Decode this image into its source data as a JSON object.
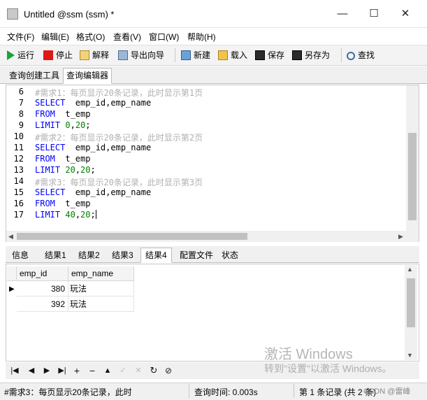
{
  "window": {
    "title": "Untitled @ssm (ssm) *",
    "minimize": "—",
    "maximize": "☐",
    "close": "✕"
  },
  "menu": [
    "文件(F)",
    "编辑(E)",
    "格式(O)",
    "查看(V)",
    "窗口(W)",
    "帮助(H)"
  ],
  "toolbar": {
    "run": "运行",
    "stop": "停止",
    "explain": "解释",
    "export": "导出向导",
    "new": "新建",
    "load": "载入",
    "save": "保存",
    "save_as": "另存为",
    "find": "查找"
  },
  "query_tabs": [
    "查询创建工具",
    "查询编辑器"
  ],
  "editor": {
    "line_numbers": [
      "6",
      "7",
      "8",
      "9",
      "10",
      "11",
      "12",
      "13",
      "14",
      "15",
      "16",
      "17"
    ],
    "lines": {
      "l6": "#需求1：每页显示20条记录，此时显示第1页",
      "l7_kw": "SELECT",
      "l7_rest": "  emp_id,emp_name",
      "l8_kw": "FROM",
      "l8_rest": "  t_emp",
      "l9_kw": "LIMIT",
      "l9_a": "0",
      "l9_sep": ",",
      "l9_b": "20",
      "l9_end": ";",
      "l10": "#需求2：每页显示20条记录，此时显示第2页",
      "l11_kw": "SELECT",
      "l11_rest": "  emp_id,emp_name",
      "l12_kw": "FROM",
      "l12_rest": "  t_emp",
      "l13_kw": "LIMIT",
      "l13_a": "20",
      "l13_sep": ",",
      "l13_b": "20",
      "l13_end": ";",
      "l14": "#需求3：每页显示20条记录，此时显示第3页",
      "l15_kw": "SELECT",
      "l15_rest": "  emp_id,emp_name",
      "l16_kw": "FROM",
      "l16_rest": "  t_emp",
      "l17_kw": "LIMIT",
      "l17_a": "40",
      "l17_sep": ",",
      "l17_b": "20",
      "l17_end": ";"
    }
  },
  "result_tabs": [
    "信息",
    "结果1",
    "结果2",
    "结果3",
    "结果4",
    "配置文件",
    "状态"
  ],
  "grid": {
    "columns": [
      "emp_id",
      "emp_name"
    ],
    "rows": [
      [
        "380",
        "玩法"
      ],
      [
        "392",
        "玩法"
      ]
    ]
  },
  "watermark": {
    "line1": "激活 Windows",
    "line2": "转到\"设置\"以激活 Windows。"
  },
  "status": {
    "sql": "#需求3：每页显示20条记录，此时",
    "query_time": "查询时间: 0.003s",
    "record": "第 1 条记录 (共 2 条)",
    "csdn": "CSDN @雷峰"
  },
  "colors": {
    "keyword": "#0000ff",
    "comment": "#b0b0b0",
    "number": "#008000"
  }
}
